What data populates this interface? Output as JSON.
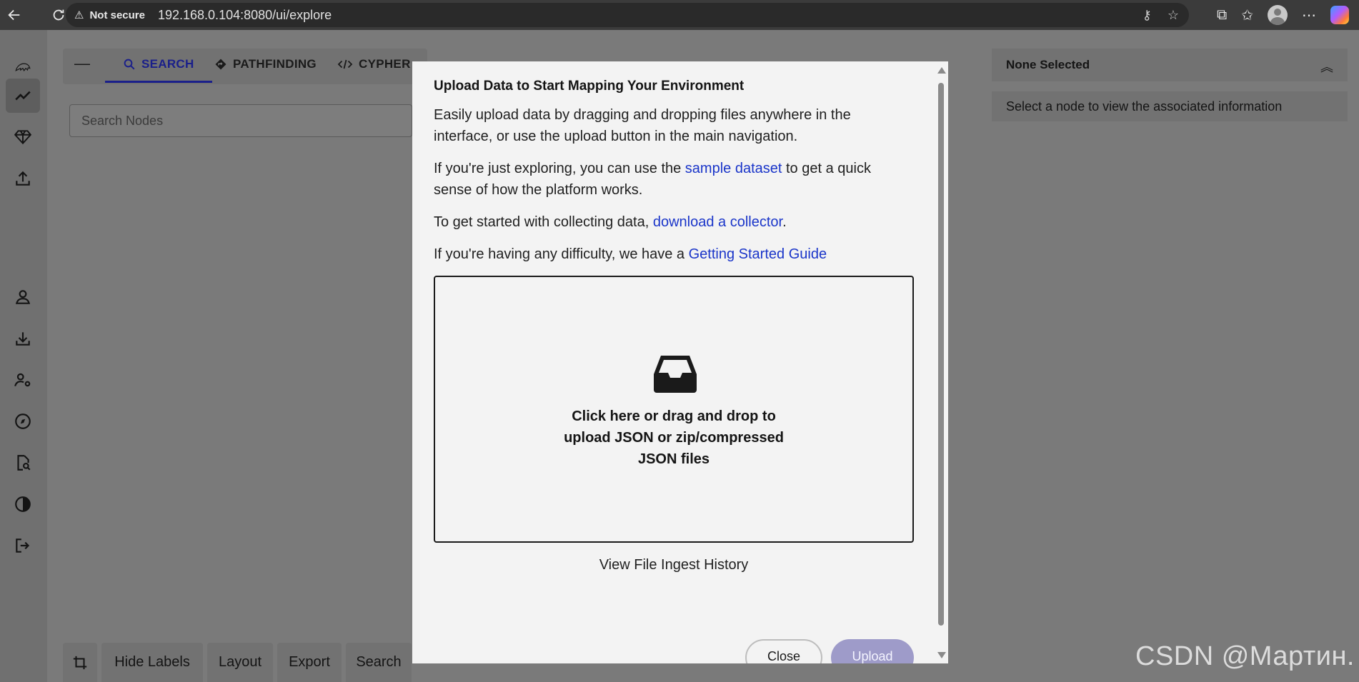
{
  "browser": {
    "security_label": "Not secure",
    "url": "192.168.0.104:8080/ui/explore"
  },
  "explore": {
    "tabs": [
      {
        "label": "SEARCH",
        "icon": "search-icon"
      },
      {
        "label": "PATHFINDING",
        "icon": "diamond-arrow-icon"
      },
      {
        "label": "CYPHER",
        "icon": "code-icon"
      }
    ],
    "active_tab": "SEARCH",
    "search": {
      "placeholder": "Search Nodes",
      "value": ""
    }
  },
  "toolbar": {
    "hide_labels": "Hide Labels",
    "layout": "Layout",
    "export": "Export",
    "search": "Search"
  },
  "right_panel": {
    "title": "None Selected",
    "message": "Select a node to view the associated information"
  },
  "modal": {
    "title": "Upload Data to Start Mapping Your Environment",
    "p1": "Easily upload data by dragging and dropping files anywhere in the interface, or use the upload button in the main navigation.",
    "p2_before": "If you're just exploring, you can use the ",
    "p2_link": "sample dataset",
    "p2_after": " to get a quick sense of how the platform works.",
    "p3_before": "To get started with collecting data, ",
    "p3_link": "download a collector",
    "p3_after": ".",
    "p4_before": "If you're having any difficulty, we have a ",
    "p4_link": "Getting Started Guide",
    "dropzone_text": "Click here or drag and drop to upload JSON or zip/compressed JSON files",
    "history_link": "View File Ingest History",
    "close_label": "Close",
    "upload_label": "Upload"
  },
  "watermark": "CSDN @Мартин.",
  "colors": {
    "accent": "#1a1f8a",
    "link": "#1a35c9",
    "upload_disabled": "#9e9bc9",
    "overlay": "#7a7a7a"
  }
}
